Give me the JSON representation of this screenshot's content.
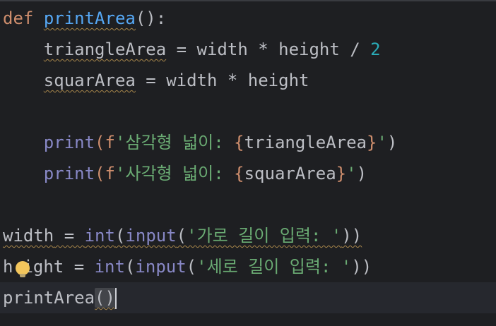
{
  "code": {
    "line1": {
      "kw_def": "def",
      "fn_name": "printArea",
      "tail": "():"
    },
    "line2": {
      "indent": "    ",
      "var": "triangleArea",
      "op1": " = width * height / ",
      "num": "2"
    },
    "line3": {
      "indent": "    ",
      "var": "squarArea",
      "op": " = width * height"
    },
    "line5": {
      "indent": "    ",
      "print": "print",
      "open": "(f",
      "str_start": "'삼각형 넓이: ",
      "brace_open": "{",
      "expr": "triangleArea",
      "brace_close": "}",
      "str_end": "'",
      "close": ")"
    },
    "line6": {
      "indent": "    ",
      "print": "print",
      "open": "(f",
      "str_start": "'사각형 넓이: ",
      "brace_open": "{",
      "expr": "squarArea",
      "brace_close": "}",
      "str_end": "'",
      "close": ")"
    },
    "line8": {
      "var": "width",
      "eq": " = ",
      "int": "int",
      "p1": "(",
      "input": "input",
      "p2": "(",
      "str": "'가로 길이 입력: '",
      "p3": "))"
    },
    "line9": {
      "var_start": "h",
      "var_end": "ight",
      "eq": " = ",
      "int": "int",
      "p1": "(",
      "input": "input",
      "p2": "(",
      "str": "'세로 길이 입력: '",
      "p3": "))"
    },
    "line10": {
      "call": "printArea",
      "open": "(",
      "close": ")"
    }
  },
  "icons": {
    "intention_bulb": "lightbulb-icon"
  },
  "colors": {
    "background": "#1e1f22",
    "keyword": "#cf8e6d",
    "function": "#56a8f5",
    "builtin": "#8888c6",
    "number": "#2aacb8",
    "string": "#6aab73",
    "text": "#bcbec4"
  }
}
